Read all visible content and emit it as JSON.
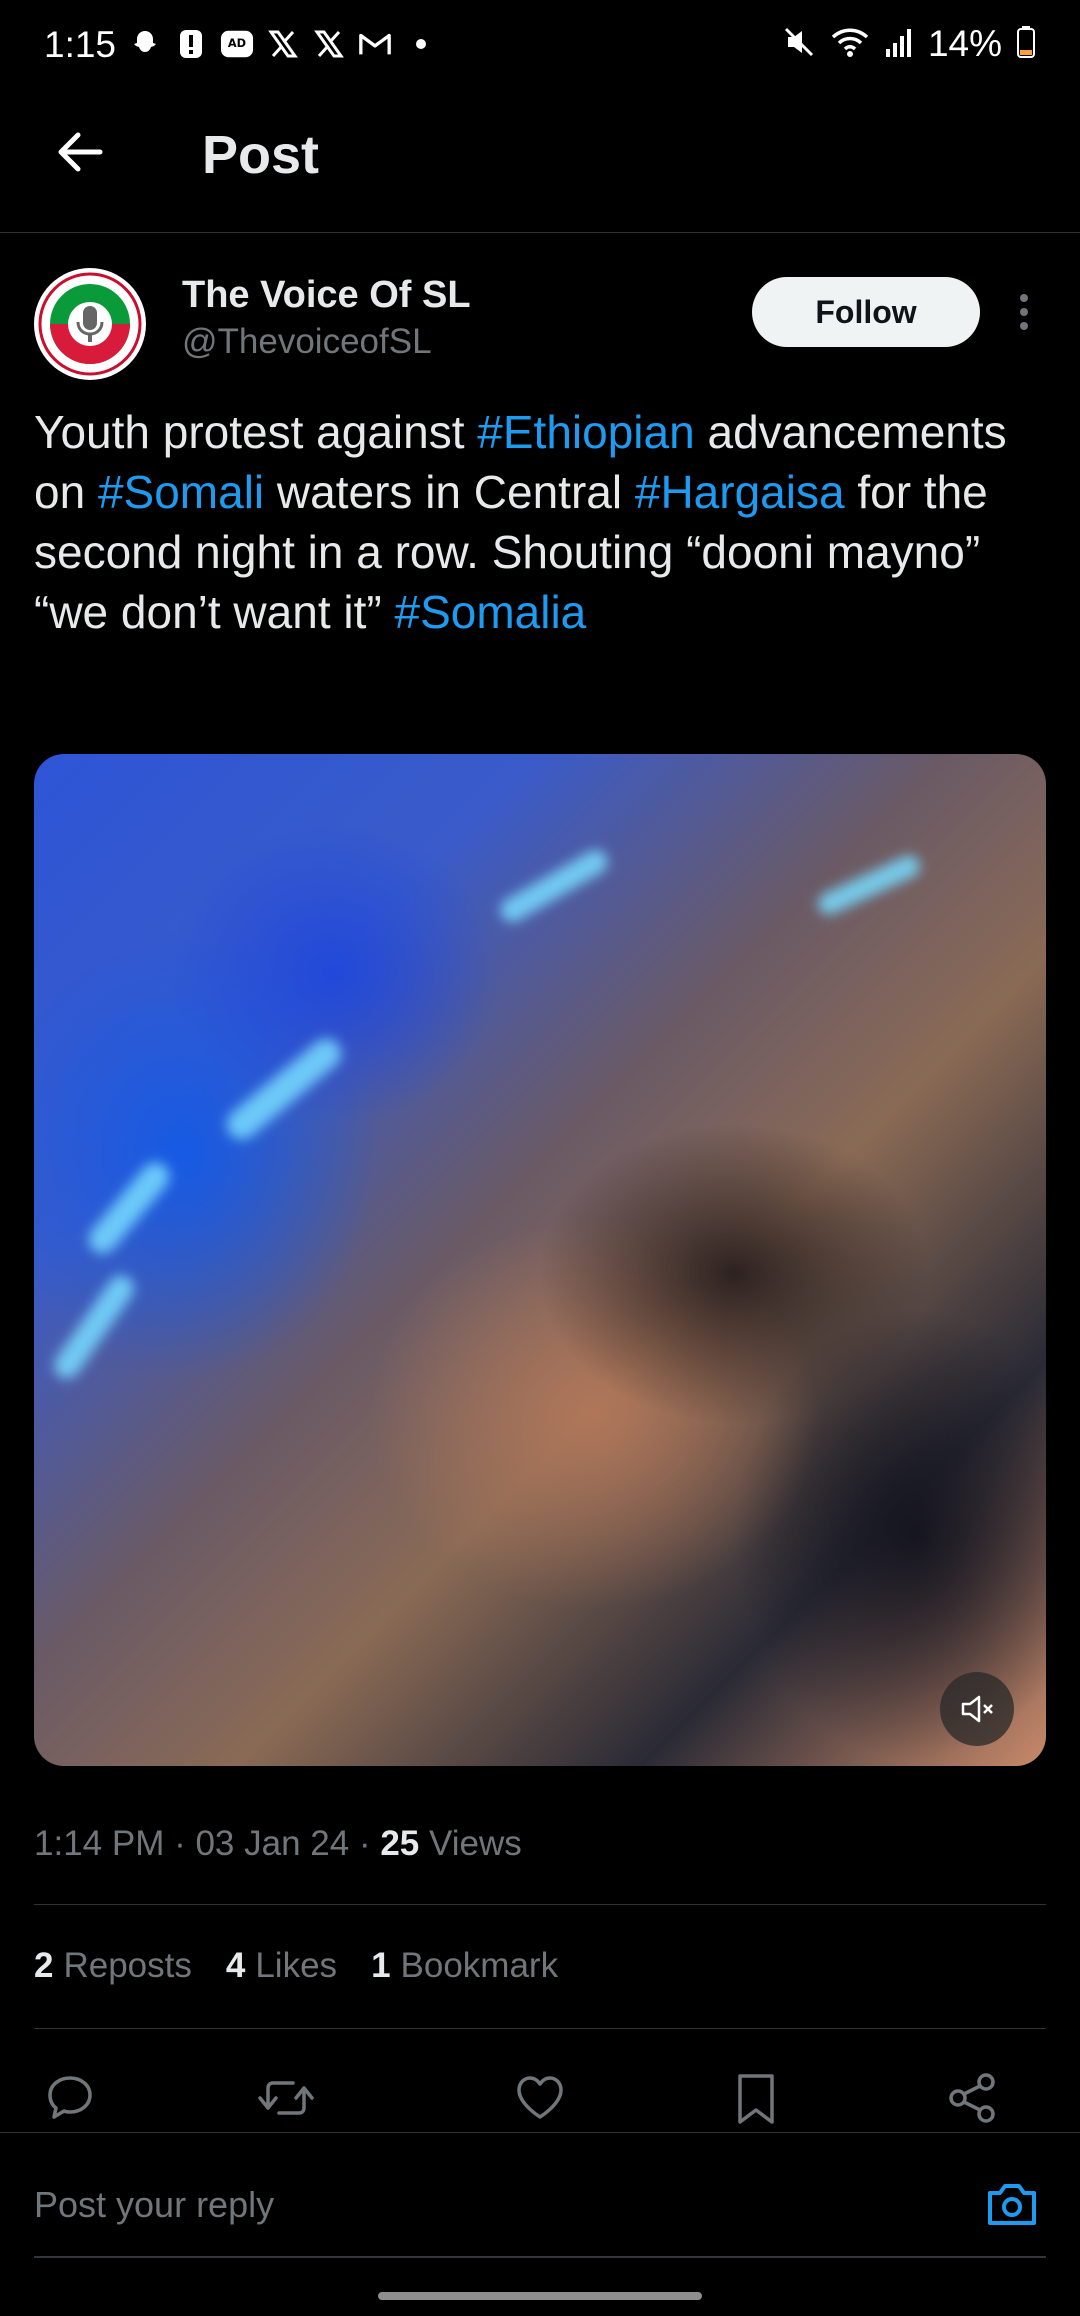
{
  "status_bar": {
    "time": "1:15",
    "battery": "14%",
    "icons": [
      "snapchat-icon",
      "alert-icon",
      "ad-blocker-icon",
      "x-icon",
      "x-icon",
      "gmail-icon",
      "dot-icon",
      "mute-icon",
      "wifi-icon",
      "signal-icon",
      "battery-icon"
    ]
  },
  "header": {
    "title": "Post",
    "back_icon": "arrow-left-icon"
  },
  "post": {
    "author": {
      "name": "The Voice Of SL",
      "handle": "@ThevoiceofSL"
    },
    "follow_label": "Follow",
    "text": {
      "p1": "Youth protest against ",
      "tag1": "#Ethiopian",
      "p2": " advancements on ",
      "tag2": "#Somali",
      "p3": " waters in Central ",
      "tag3": "#Hargaisa",
      "p4": " for the second night in a row. Shouting “dooni mayno” “we don’t want it” ",
      "tag4": "#Somalia"
    },
    "meta": {
      "time": "1:14 PM",
      "sep": " · ",
      "date": "03 Jan 24",
      "views_count": "25",
      "views_label": "Views"
    },
    "stats": {
      "reposts_count": "2",
      "reposts_label": "Reposts",
      "likes_count": "4",
      "likes_label": "Likes",
      "bookmarks_count": "1",
      "bookmarks_label": "Bookmark"
    }
  },
  "reply": {
    "placeholder": "Post your reply"
  },
  "colors": {
    "background": "#000000",
    "text": "#e7e9ea",
    "muted": "#71767b",
    "accent": "#1d9bf0",
    "divider": "#2f3336"
  }
}
